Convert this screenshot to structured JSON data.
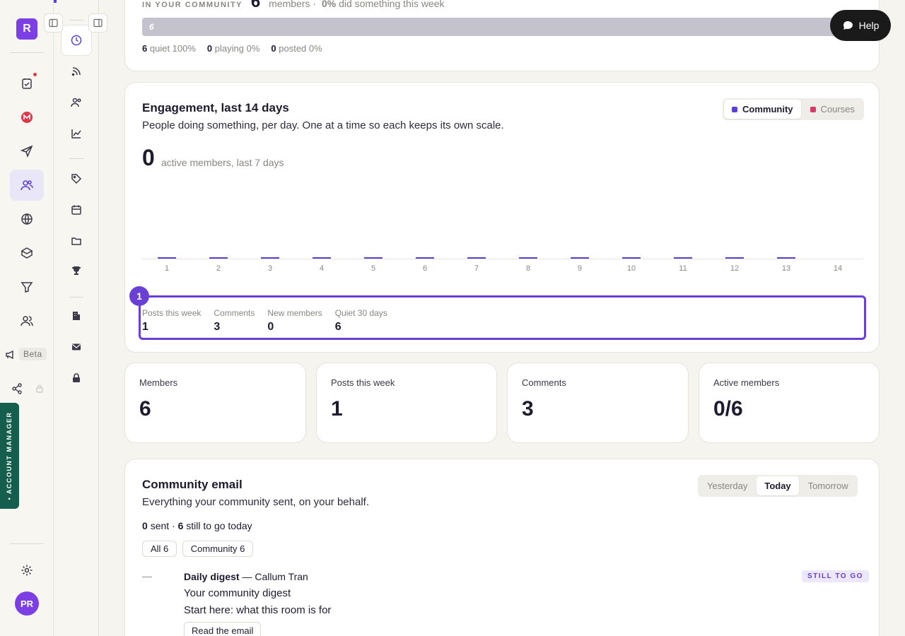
{
  "rail": {
    "logo_letter": "R",
    "beta_label": "Beta",
    "account_manager_label": "• ACCOUNT MANAGER",
    "avatar_initials": "PR"
  },
  "help": {
    "label": "Help"
  },
  "overview": {
    "eyebrow": "IN YOUR COMMUNITY",
    "count": "6",
    "members_label": "members ·",
    "pct": "0%",
    "did_text": "did something this week",
    "bar_label": "6",
    "breakdown": [
      {
        "count": "6",
        "label": "quiet 100%"
      },
      {
        "count": "0",
        "label": "playing 0%"
      },
      {
        "count": "0",
        "label": "posted 0%"
      }
    ]
  },
  "engagement": {
    "title": "Engagement, last 14 days",
    "subtitle": "People doing something, per day. One at a time so each keeps its own scale.",
    "toggle": [
      "Community",
      "Courses"
    ],
    "big_number": "0",
    "big_label": "active members, last 7 days",
    "marker": "1",
    "stats": [
      {
        "label": "Posts this week",
        "value": "1"
      },
      {
        "label": "Comments",
        "value": "3"
      },
      {
        "label": "New members",
        "value": "0"
      },
      {
        "label": "Quiet 30 days",
        "value": "6"
      }
    ]
  },
  "chart_data": {
    "type": "bar",
    "categories": [
      "1",
      "2",
      "3",
      "4",
      "5",
      "6",
      "7",
      "8",
      "9",
      "10",
      "11",
      "12",
      "13",
      "14"
    ],
    "values": [
      0,
      0,
      0,
      0,
      0,
      0,
      0,
      0,
      0,
      0,
      0,
      0,
      0,
      0
    ],
    "series_name": "Community",
    "color": "#5b3fd6"
  },
  "stat_cards": [
    {
      "label": "Members",
      "value": "6"
    },
    {
      "label": "Posts this week",
      "value": "1"
    },
    {
      "label": "Comments",
      "value": "3"
    },
    {
      "label": "Active members",
      "value": "0/6"
    }
  ],
  "email": {
    "title": "Community email",
    "subtitle": "Everything your community sent, on your behalf.",
    "days": [
      "Yesterday",
      "Today",
      "Tomorrow"
    ],
    "sent_count": "0",
    "sent_label": "sent ·",
    "togo_count": "6",
    "togo_label": "still to go today",
    "chips": [
      "All 6",
      "Community 6"
    ],
    "item": {
      "dash": "—",
      "name": "Daily digest",
      "sep": "— Callum Tran",
      "subject": "Your community digest",
      "preview": "Start here: what this room is for",
      "button": "Read the email",
      "status": "STILL TO GO"
    }
  },
  "colors": {
    "accent": "#7b3fe4",
    "bar": "#5b3fd6",
    "courses": "#d63a6a",
    "account": "#155d4c"
  }
}
